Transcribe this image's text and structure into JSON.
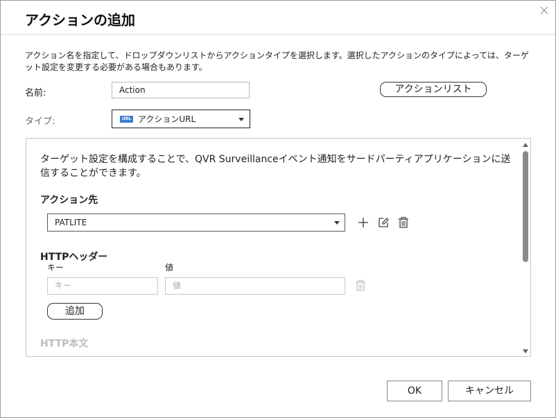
{
  "dialog": {
    "title": "アクションの追加",
    "description": "アクション名を指定して、ドロップダウンリストからアクションタイプを選択します。選択したアクションのタイプによっては、ターゲット設定を変更する必要がある場合もあります。"
  },
  "form": {
    "name_label": "名前:",
    "name_value": "Action",
    "action_list_button": "アクションリスト",
    "type_label": "タイプ:",
    "type_icon": "URL",
    "type_value": "アクションURL"
  },
  "panel": {
    "description": "ターゲット設定を構成することで、QVR Surveillanceイベント通知をサードパーティアプリケーションに送信することができます。",
    "destination_heading": "アクション先",
    "destination_value": "PATLITE",
    "http_header_heading": "HTTPヘッダー",
    "key_label": "キー",
    "value_label": "値",
    "key_placeholder": "キー",
    "value_placeholder": "値",
    "add_button": "追加",
    "http_body_heading": "HTTP本文"
  },
  "footer": {
    "ok": "OK",
    "cancel": "キャンセル"
  },
  "icons": [
    "close-icon",
    "url-icon",
    "plus-icon",
    "edit-icon",
    "trash-icon",
    "chevron-down-icon",
    "scroll-up-icon",
    "scroll-down-icon"
  ]
}
